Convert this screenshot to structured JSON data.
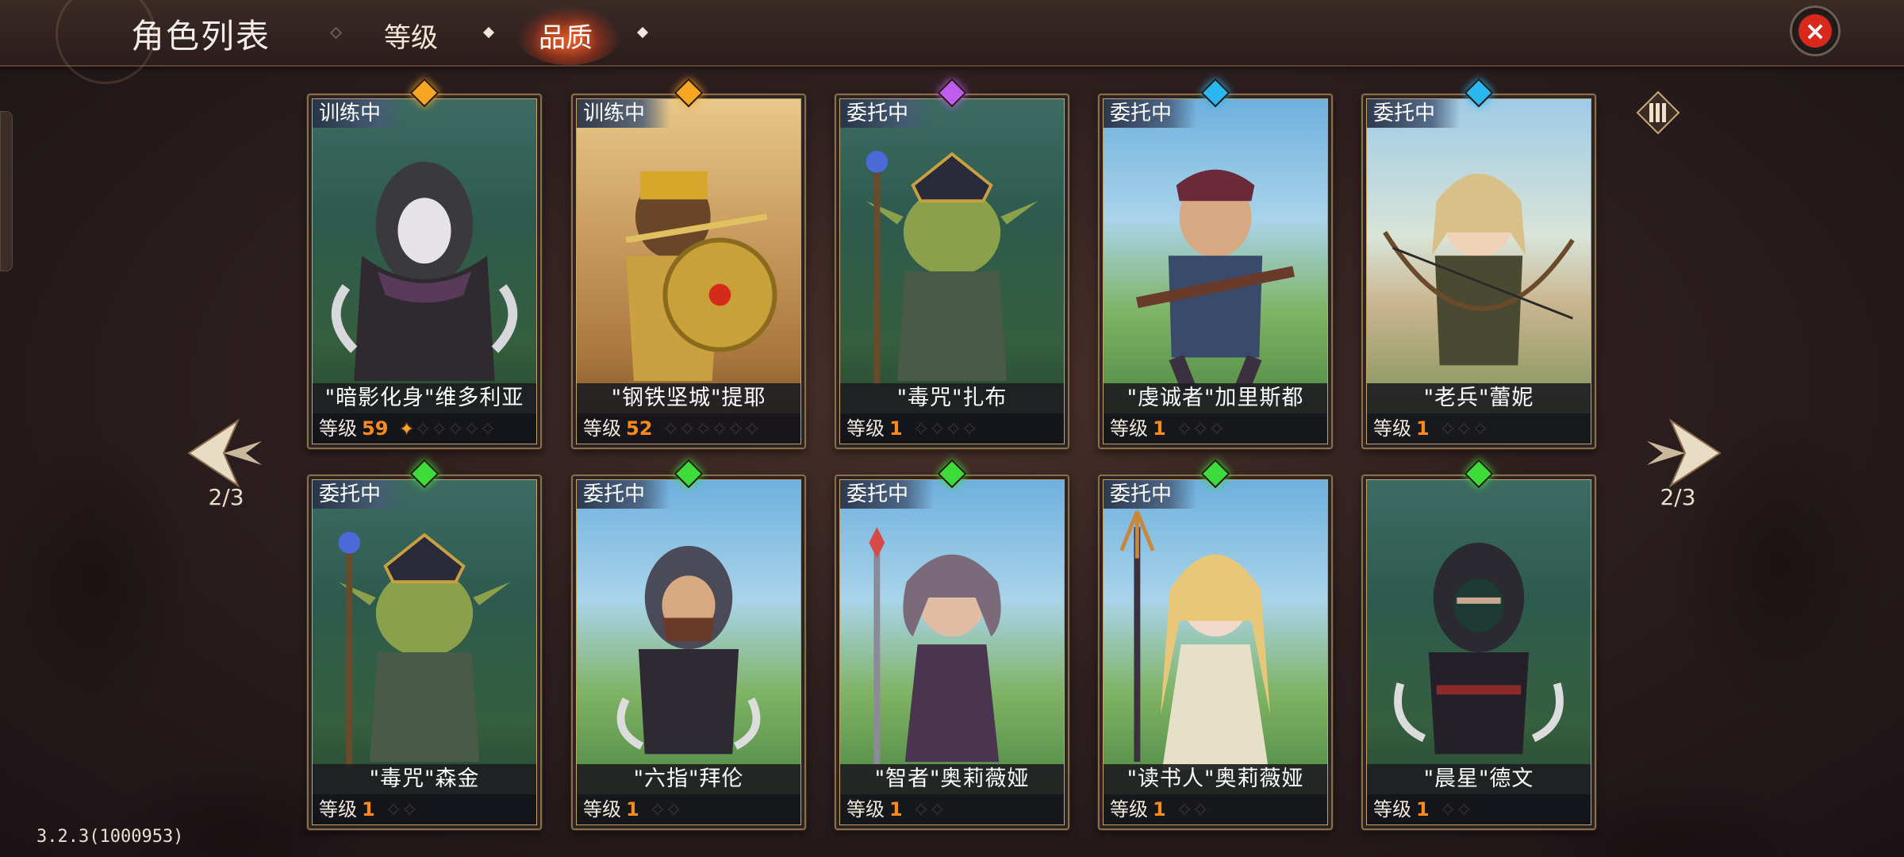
{
  "header": {
    "title": "角色列表",
    "tabs": [
      {
        "label": "等级",
        "active": false
      },
      {
        "label": "品质",
        "active": true
      }
    ]
  },
  "pager": {
    "left": "2/3",
    "right": "2/3"
  },
  "version": "3.2.3(1000953)",
  "level_label": "等级",
  "colors": {
    "accent": "#ff8a1c",
    "close_red": "#d82a1c",
    "gem_orange": "#f5a623",
    "gem_purple": "#c05cf0",
    "gem_blue": "#2ab6f0",
    "gem_green": "#3ddc3a"
  },
  "cards": [
    {
      "status": "训练中",
      "name": "\"暗影化身\"维多利亚",
      "level": "59",
      "quality": "orange",
      "stars_lit": 1,
      "stars_total": 6,
      "scene": "forest",
      "figure": "hooded-assassin-icon"
    },
    {
      "status": "训练中",
      "name": "\"钢铁坚城\"提耶",
      "level": "52",
      "quality": "orange",
      "stars_lit": 0,
      "stars_total": 6,
      "scene": "desert",
      "figure": "shield-warrior-icon"
    },
    {
      "status": "委托中",
      "name": "\"毒咒\"扎布",
      "level": "1",
      "quality": "purple",
      "stars_lit": 0,
      "stars_total": 4,
      "scene": "forest",
      "figure": "goblin-shaman-icon"
    },
    {
      "status": "委托中",
      "name": "\"虔诚者\"加里斯都",
      "level": "1",
      "quality": "blue",
      "stars_lit": 0,
      "stars_total": 3,
      "scene": "plains",
      "figure": "crossbowman-icon"
    },
    {
      "status": "委托中",
      "name": "\"老兵\"蕾妮",
      "level": "1",
      "quality": "blue",
      "stars_lit": 0,
      "stars_total": 3,
      "scene": "cliff",
      "figure": "archer-icon"
    },
    {
      "status": "委托中",
      "name": "\"毒咒\"森金",
      "level": "1",
      "quality": "green",
      "stars_lit": 0,
      "stars_total": 2,
      "scene": "forest",
      "figure": "goblin-shaman-icon"
    },
    {
      "status": "委托中",
      "name": "\"六指\"拜伦",
      "level": "1",
      "quality": "green",
      "stars_lit": 0,
      "stars_total": 2,
      "scene": "plains",
      "figure": "hooded-rogue-icon"
    },
    {
      "status": "委托中",
      "name": "\"智者\"奥莉薇娅",
      "level": "1",
      "quality": "green",
      "stars_lit": 0,
      "stars_total": 2,
      "scene": "plains",
      "figure": "sorceress-icon"
    },
    {
      "status": "委托中",
      "name": "\"读书人\"奥莉薇娅",
      "level": "1",
      "quality": "green",
      "stars_lit": 0,
      "stars_total": 2,
      "scene": "plains",
      "figure": "priestess-icon"
    },
    {
      "status": "",
      "name": "\"晨星\"德文",
      "level": "1",
      "quality": "green",
      "stars_lit": 0,
      "stars_total": 2,
      "scene": "forest",
      "figure": "masked-rogue-icon"
    }
  ]
}
